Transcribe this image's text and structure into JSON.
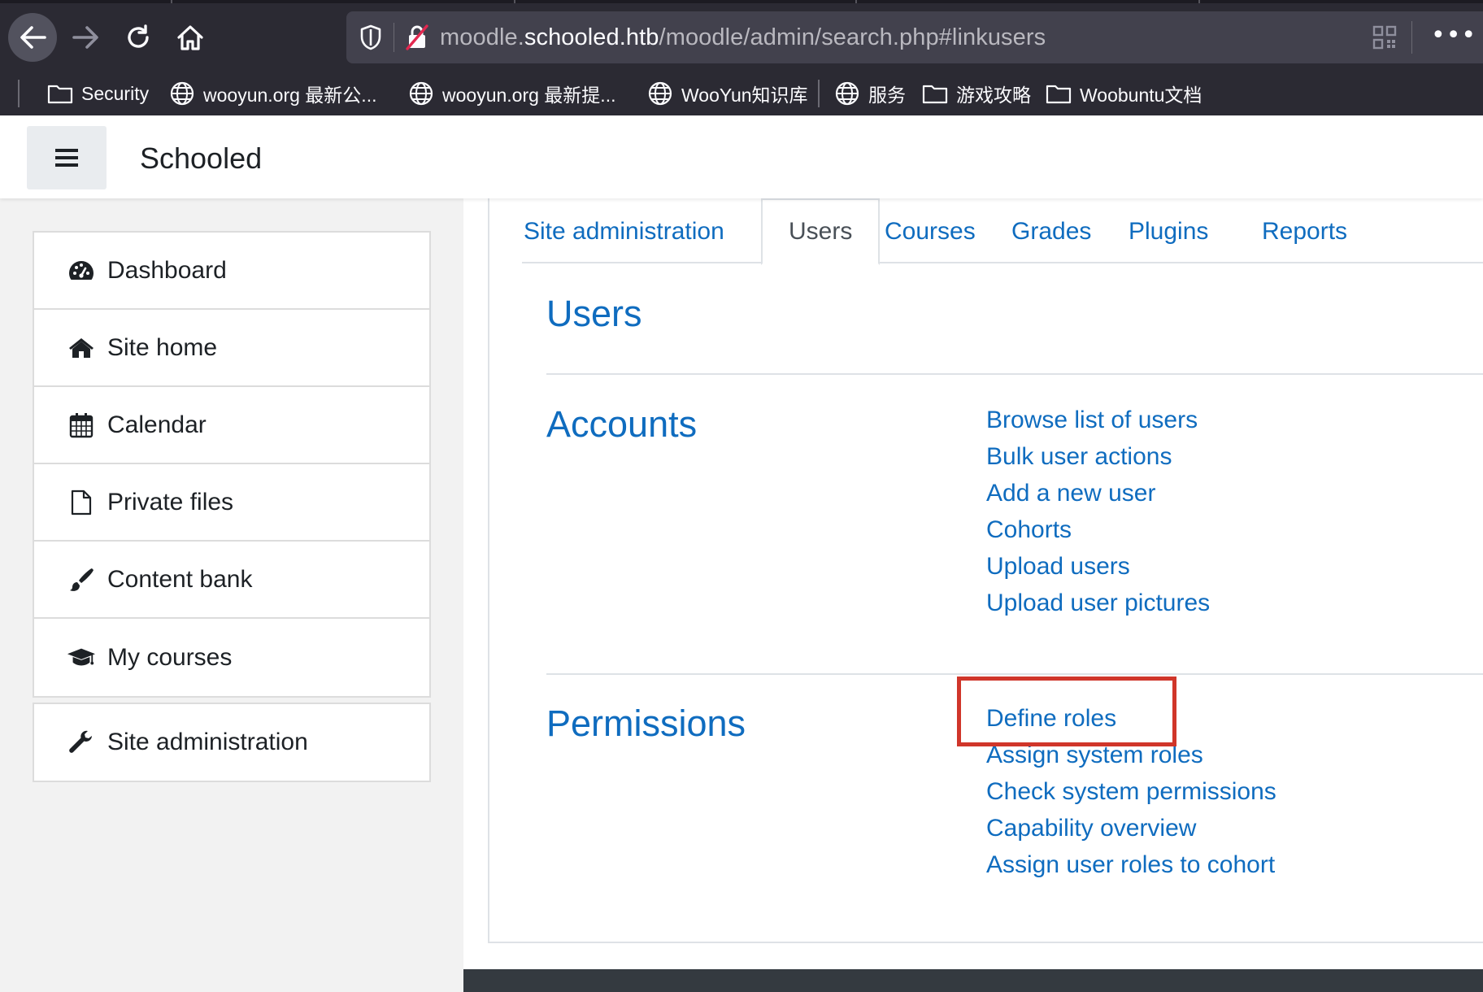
{
  "browser": {
    "url_prefix": "moodle.",
    "url_host": "schooled.htb",
    "url_path": "/moodle/admin/search.php#linkusers",
    "bookmarks": [
      {
        "label": "Security",
        "icon": "folder-icon"
      },
      {
        "label": "wooyun.org 最新公...",
        "icon": "globe-icon"
      },
      {
        "label": "wooyun.org 最新提...",
        "icon": "globe-icon"
      },
      {
        "label": "WooYun知识库",
        "icon": "globe-icon"
      },
      {
        "label": "服务",
        "icon": "globe-icon"
      },
      {
        "label": "游戏攻略",
        "icon": "folder-icon"
      },
      {
        "label": "Woobuntu文档",
        "icon": "folder-icon"
      }
    ]
  },
  "header": {
    "site_name": "Schooled"
  },
  "sidebar": {
    "items": [
      {
        "label": "Dashboard",
        "icon": "dashboard-icon"
      },
      {
        "label": "Site home",
        "icon": "home-icon"
      },
      {
        "label": "Calendar",
        "icon": "calendar-icon"
      },
      {
        "label": "Private files",
        "icon": "file-icon"
      },
      {
        "label": "Content bank",
        "icon": "paintbrush-icon"
      },
      {
        "label": "My courses",
        "icon": "graduation-cap-icon"
      }
    ],
    "admin": {
      "label": "Site administration",
      "icon": "wrench-icon"
    }
  },
  "main": {
    "tabs": [
      {
        "label": "Site administration",
        "active": false
      },
      {
        "label": "Users",
        "active": true
      },
      {
        "label": "Courses",
        "active": false
      },
      {
        "label": "Grades",
        "active": false
      },
      {
        "label": "Plugins",
        "active": false
      },
      {
        "label": "Reports",
        "active": false
      }
    ],
    "heading": "Users",
    "sections": [
      {
        "title": "Accounts",
        "links": [
          "Browse list of users",
          "Bulk user actions",
          "Add a new user",
          "Cohorts",
          "Upload users",
          "Upload user pictures"
        ]
      },
      {
        "title": "Permissions",
        "links": [
          "Define roles",
          "Assign system roles",
          "Check system permissions",
          "Capability overview",
          "Assign user roles to cohort"
        ]
      }
    ]
  },
  "colors": {
    "link": "#0f6cbf",
    "highlight": "#d0362a",
    "chrome_bg": "#2b2a33"
  }
}
